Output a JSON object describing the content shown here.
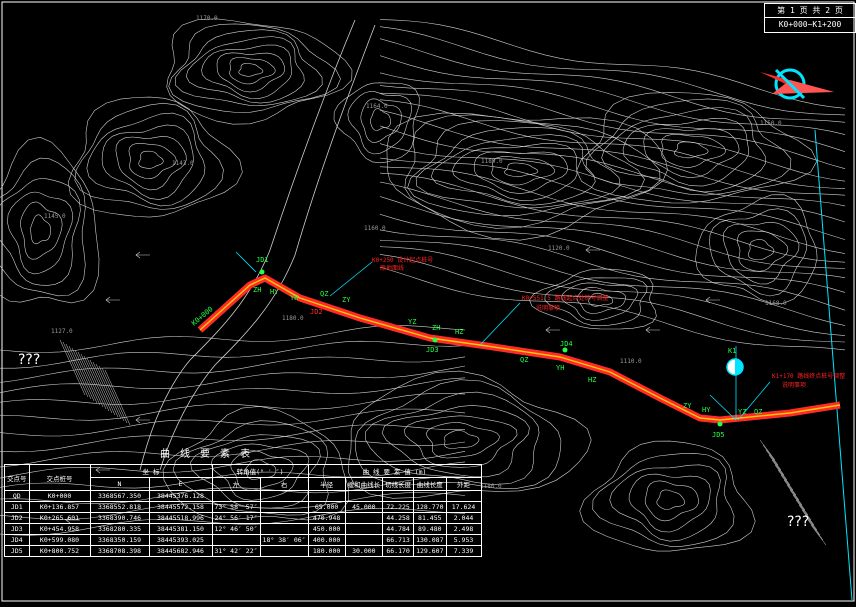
{
  "titleblock": {
    "page": "第 1 页 共 2 页",
    "range": "K0+000~K1+200"
  },
  "contour_labels": [
    "1170.0",
    "1164.0",
    "1189.0",
    "1160.0",
    "1143.0",
    "1145.0",
    "1180.0",
    "1120.0",
    "1127.0",
    "1110.0",
    "1168.0",
    "1150.0",
    "1180.0"
  ],
  "route_labels": {
    "start": "K0+000",
    "jd1": "JD1",
    "jd2": "JD2",
    "jd3": "JD3",
    "jd4": "JD4",
    "jd5": "JD5",
    "zd_labels": [
      "ZH",
      "HY",
      "YH",
      "QZ",
      "ZY",
      "YZ",
      "ZH",
      "HZ",
      "QZ",
      "YH",
      "HZ",
      "ZY",
      "HY",
      "YZ",
      "QZ",
      "HZ"
    ],
    "k1": "K1"
  },
  "annotations": [
    {
      "text": "K0+250 设计起点桩号",
      "sub": "原地面线"
    },
    {
      "text": "K0+551.5 路线起点处桩号调整",
      "sub": "说明事项"
    },
    {
      "text": "K1+170 路线终点桩号调整",
      "sub": "说明事项"
    }
  ],
  "unknown_marks": [
    "???",
    "???"
  ],
  "table": {
    "title": "曲 线 要 素 表",
    "header_top": [
      "交点号",
      "交点桩号",
      "坐 标",
      "转角值(° ′ ″)",
      "曲 线 要 素 值 (m)"
    ],
    "header_sub": [
      "N",
      "E",
      "左",
      "右",
      "半径",
      "缓和曲线长",
      "切线长度",
      "曲线长度",
      "外距"
    ],
    "rows": [
      [
        "QD",
        "K0+000",
        "3368567.350",
        "38445376.128",
        "",
        "",
        "",
        "",
        "",
        "",
        "",
        ""
      ],
      [
        "JD1",
        "K0+136.857",
        "3368552.818",
        "38445572.158",
        "73° 58′ 57″",
        "",
        "65.000",
        "45.000",
        "72.225",
        "128.770",
        "17.624"
      ],
      [
        "JD2",
        "K0+265.601",
        "3368390.746",
        "38445518.996",
        "24° 56′ 17″",
        "",
        "470.948",
        "",
        "44.258",
        "81.455",
        "2.044"
      ],
      [
        "JD3",
        "K0+454.958",
        "3368280.335",
        "38445381.150",
        "12° 46′ 50″",
        "",
        "450.000",
        "",
        "44.784",
        "89.480",
        "2.498"
      ],
      [
        "JD4",
        "K0+599.080",
        "3368350.159",
        "38445393.025",
        "",
        "18° 38′ 06″",
        "400.000",
        "",
        "66.713",
        "130.087",
        "5.953"
      ],
      [
        "JD5",
        "K0+800.752",
        "3368708.398",
        "38445682.946",
        "31° 42′ 22″",
        "",
        "180.000",
        "30.000",
        "66.170",
        "129.607",
        "7.339"
      ]
    ]
  },
  "colors": {
    "background": "#000000",
    "contour": "#d0d0d0",
    "road": "#ff2a2a",
    "road_center": "#ffcc00",
    "cyan": "#00e5ff",
    "green": "#22ff44",
    "red_text": "#ff2222"
  }
}
